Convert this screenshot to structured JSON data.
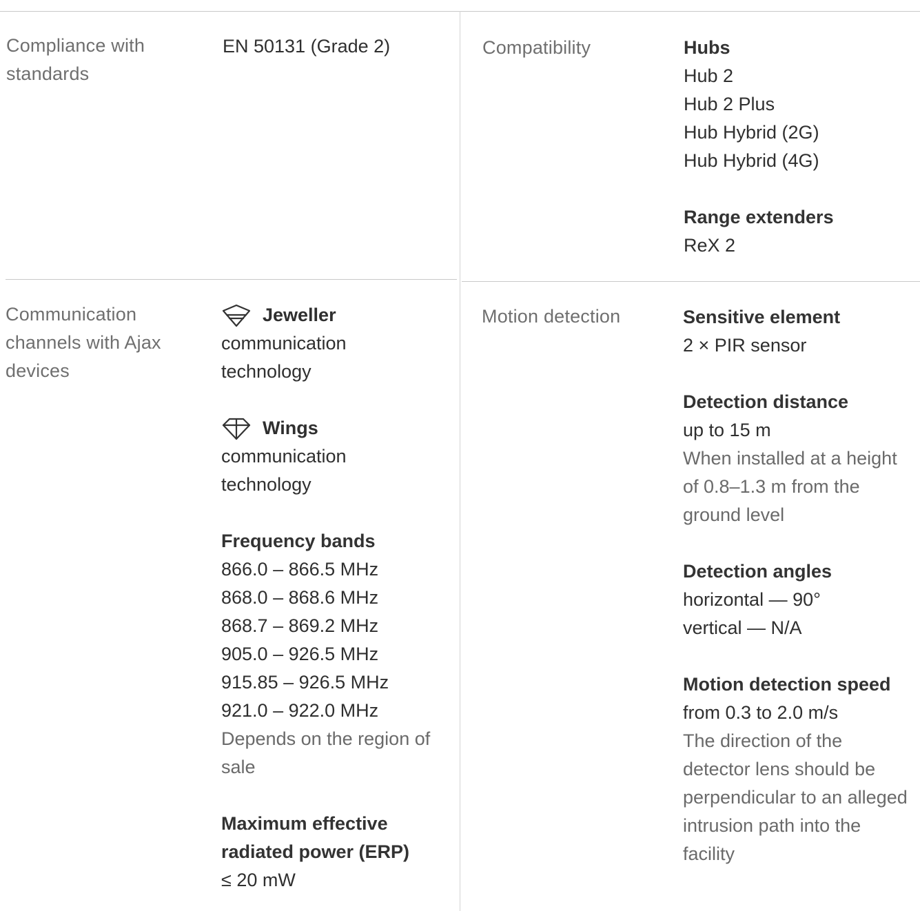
{
  "rows": [
    {
      "left": {
        "label": [
          "Compliance with",
          "standards"
        ],
        "value": "EN 50131 (Grade 2)"
      },
      "right": {
        "label": "Compatibility",
        "groups": [
          {
            "head": "Hubs",
            "lines": [
              "Hub 2",
              "Hub 2 Plus",
              "Hub Hybrid (2G)",
              "Hub Hybrid (4G)"
            ]
          },
          {
            "head": "Range extenders",
            "lines": [
              "ReX 2"
            ]
          }
        ]
      }
    },
    {
      "left": {
        "label": [
          "Communication",
          "channels with Ajax",
          "devices"
        ],
        "tech": [
          {
            "icon": "jeweller-icon",
            "name": "Jeweller",
            "desc": [
              "communication",
              "technology"
            ]
          },
          {
            "icon": "wings-icon",
            "name": "Wings",
            "desc": [
              "communication",
              "technology"
            ]
          }
        ],
        "groups": [
          {
            "head": "Frequency bands",
            "lines": [
              "866.0 – 866.5 MHz",
              "868.0 – 868.6 MHz",
              "868.7 – 869.2 MHz",
              "905.0 – 926.5 MHz",
              "915.85 – 926.5 MHz",
              "921.0 – 922.0 MHz"
            ],
            "note": [
              "Depends on the region of",
              "sale"
            ]
          },
          {
            "head": [
              "Maximum effective",
              "radiated power (ERP)"
            ],
            "lines": [
              "≤ 20 mW"
            ]
          }
        ]
      },
      "right": {
        "label": "Motion detection",
        "groups": [
          {
            "head": "Sensitive element",
            "lines": [
              "2 × PIR sensor"
            ]
          },
          {
            "head": "Detection distance",
            "lines": [
              "up to 15 m"
            ],
            "note": [
              "When installed at a height",
              "of 0.8–1.3 m from the",
              "ground level"
            ]
          },
          {
            "head": "Detection angles",
            "lines": [
              "horizontal — 90°",
              "vertical — N/A"
            ]
          },
          {
            "head": "Motion detection speed",
            "lines": [
              "from 0.3 to 2.0 m/s"
            ],
            "note": [
              "The direction of the",
              "detector lens should be",
              "perpendicular to an alleged",
              "intrusion path into the",
              "facility"
            ]
          }
        ]
      }
    }
  ]
}
